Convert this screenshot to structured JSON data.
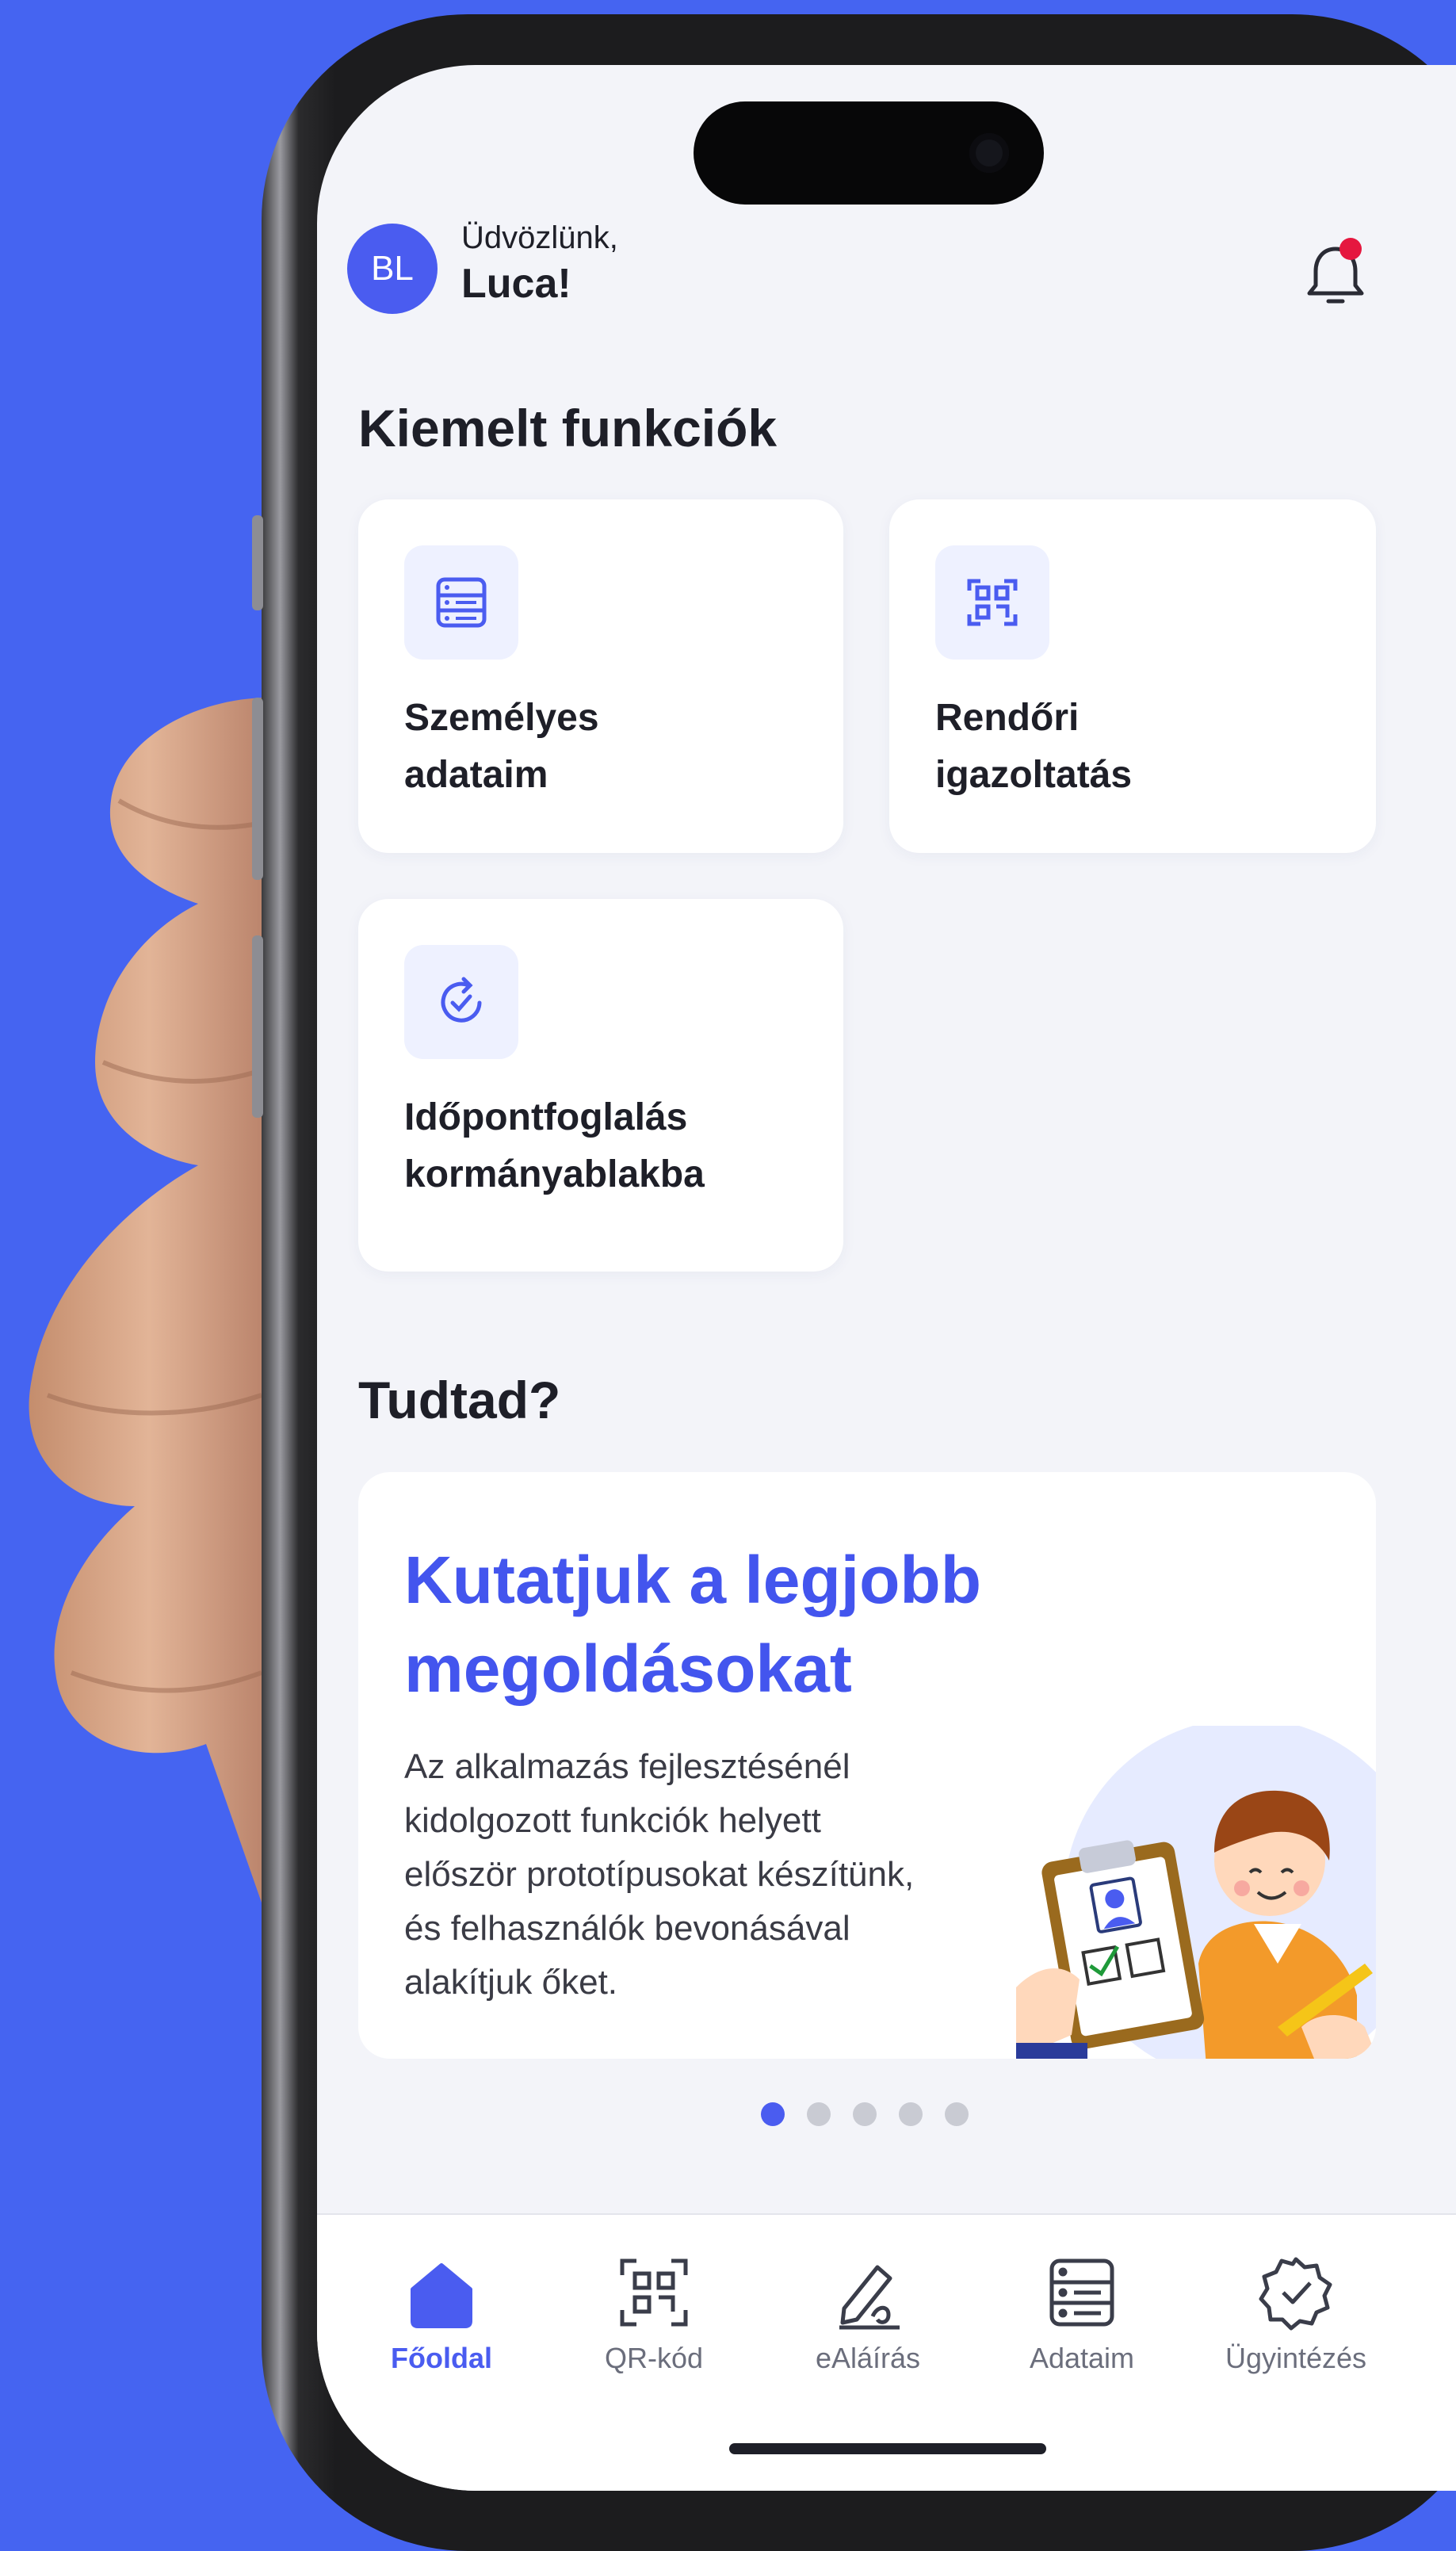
{
  "header": {
    "avatar_initials": "BL",
    "greeting": "Üdvözlünk,",
    "user_name": "Luca!",
    "notification_icon": "bell-icon",
    "has_unread_notification": true
  },
  "featured": {
    "title": "Kiemelt funkciók",
    "items": [
      {
        "label_line1": "Személyes",
        "label_line2": "adataim",
        "icon": "id-card-list-icon"
      },
      {
        "label_line1": "Rendőri",
        "label_line2": "igazoltatás",
        "icon": "qr-scan-icon"
      },
      {
        "label_line1": "Időpontfoglalás",
        "label_line2": "kormányablakba",
        "icon": "refresh-check-icon"
      }
    ]
  },
  "tips": {
    "title": "Tudtad?",
    "card": {
      "headline_line1": "Kutatjuk a legjobb",
      "headline_line2": "megoldásokat",
      "body_lines": [
        "Az alkalmazás fejlesztésénél",
        "kidolgozott funkciók helyett",
        "először prototípusokat készítünk,",
        "és felhasználók bevonásával",
        "alakítjuk őket."
      ],
      "illustration": "person-with-checklist-illustration"
    },
    "pagination": {
      "total": 5,
      "active_index": 0
    }
  },
  "tabbar": {
    "items": [
      {
        "label": "Főoldal",
        "icon": "home-icon",
        "active": true
      },
      {
        "label": "QR-kód",
        "icon": "qr-code-icon",
        "active": false
      },
      {
        "label": "eAláírás",
        "icon": "signature-pen-icon",
        "active": false
      },
      {
        "label": "Adataim",
        "icon": "data-list-icon",
        "active": false
      },
      {
        "label": "Ügyintézés",
        "icon": "verified-badge-icon",
        "active": false
      }
    ]
  },
  "colors": {
    "background": "#4564f1",
    "accent": "#4a5cf0",
    "screen": "#f3f4f9",
    "notification_dot": "#e5173f"
  }
}
